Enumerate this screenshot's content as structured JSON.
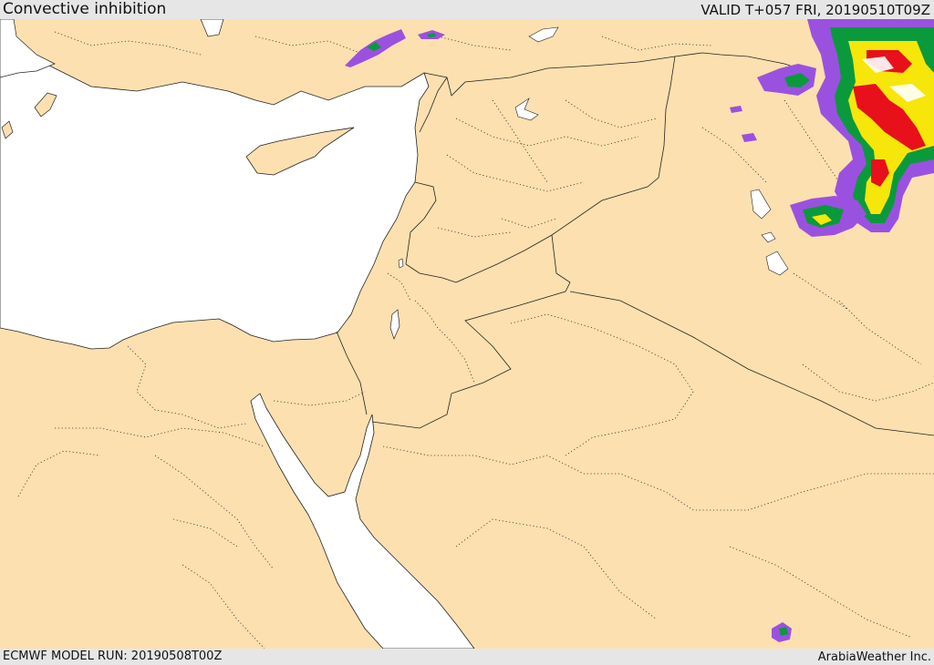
{
  "header": {
    "title": "Convective inhibition",
    "valid": "VALID T+057 FRI, 20190510T09Z"
  },
  "footer": {
    "model_run": "ECMWF MODEL RUN: 20190508T00Z",
    "credit": "ArabiaWeather Inc."
  },
  "colors": {
    "land": "#fde0af",
    "water": "#ffffff",
    "bars": "#e6e6e6",
    "cin_purple": "#9b51e0",
    "cin_green": "#0a9a3c",
    "cin_yellow": "#f7e60a",
    "cin_red": "#e8101b"
  }
}
